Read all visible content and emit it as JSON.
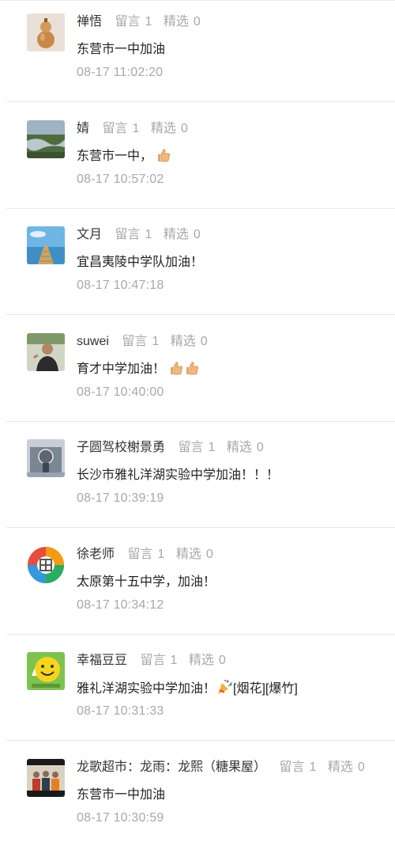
{
  "comments": [
    {
      "name": "禅悟",
      "reply_label": "留言",
      "reply_count": "1",
      "featured_label": "精选",
      "featured_count": "0",
      "text": "东营市一中加油",
      "time": "08-17 11:02:20",
      "avatar": "gourd-avatar"
    },
    {
      "name": "婧",
      "reply_label": "留言",
      "reply_count": "1",
      "featured_label": "精选",
      "featured_count": "0",
      "text": "东营市一中，",
      "time": "08-17 10:57:02",
      "avatar": "landscape-avatar"
    },
    {
      "name": "文月",
      "reply_label": "留言",
      "reply_count": "1",
      "featured_label": "精选",
      "featured_count": "0",
      "text": "宜昌夷陵中学队加油！",
      "time": "08-17 10:47:18",
      "avatar": "boardwalk-avatar"
    },
    {
      "name": "suwei",
      "reply_label": "留言",
      "reply_count": "1",
      "featured_label": "精选",
      "featured_count": "0",
      "text": "育才中学加油！",
      "time": "08-17 10:40:00",
      "avatar": "person-avatar"
    },
    {
      "name": "子圆驾校榭景勇",
      "reply_label": "留言",
      "reply_count": "1",
      "featured_label": "精选",
      "featured_count": "0",
      "text": "长沙市雅礼洋湖实验中学加油！！！",
      "time": "08-17 10:39:19",
      "avatar": "building-avatar"
    },
    {
      "name": "徐老师",
      "reply_label": "留言",
      "reply_count": "1",
      "featured_label": "精选",
      "featured_count": "0",
      "text": "太原第十五中学，加油！",
      "time": "08-17 10:34:12",
      "avatar": "colorful-logo-avatar"
    },
    {
      "name": "幸福豆豆",
      "reply_label": "留言",
      "reply_count": "1",
      "featured_label": "精选",
      "featured_count": "0",
      "text": "雅礼洋湖实验中学加油！",
      "text_suffix": "[烟花][爆竹]",
      "time": "08-17 10:31:33",
      "avatar": "smiley-avatar"
    },
    {
      "name": "龙歌超市：龙雨：龙熙（糖果屋）",
      "reply_label": "留言",
      "reply_count": "1",
      "featured_label": "精选",
      "featured_count": "0",
      "text": "东营市一中加油",
      "time": "08-17 10:30:59",
      "avatar": "group-photo-avatar"
    }
  ],
  "colors": {
    "name": "#333333",
    "muted": "#a8a8a8",
    "text": "#222222",
    "divider": "#e8e8e8"
  }
}
